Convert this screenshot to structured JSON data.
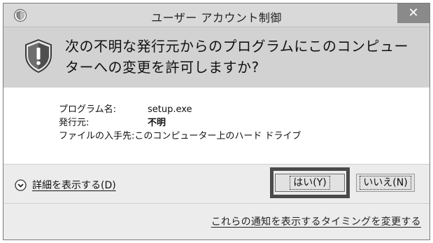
{
  "window": {
    "title": "ユーザー アカウント制御",
    "close_glyph": "✕",
    "title_icon": "uac-shield-icon"
  },
  "header": {
    "question": "次の不明な発行元からのプログラムにこのコンピューターへの変更を許可しますか?",
    "icon": "warning-shield-icon"
  },
  "details": {
    "program_label": "プログラム名:",
    "program_value": "setup.exe",
    "publisher_label": "発行元:",
    "publisher_value": "不明",
    "origin_label": "ファイルの入手先:",
    "origin_value": "このコンピューター上のハード ドライブ"
  },
  "footer": {
    "expand_label": "詳細を表示する(D)",
    "expand_icon": "chevron-down-circle-icon",
    "yes_label": "はい(Y)",
    "no_label": "いいえ(N)",
    "notify_link": "これらの通知を表示するタイミングを変更する"
  },
  "colors": {
    "titlebar": "#d9d9d9",
    "header_band": "#d2d2d2",
    "footer": "#ececec",
    "highlight_border": "#4a4a4a"
  }
}
